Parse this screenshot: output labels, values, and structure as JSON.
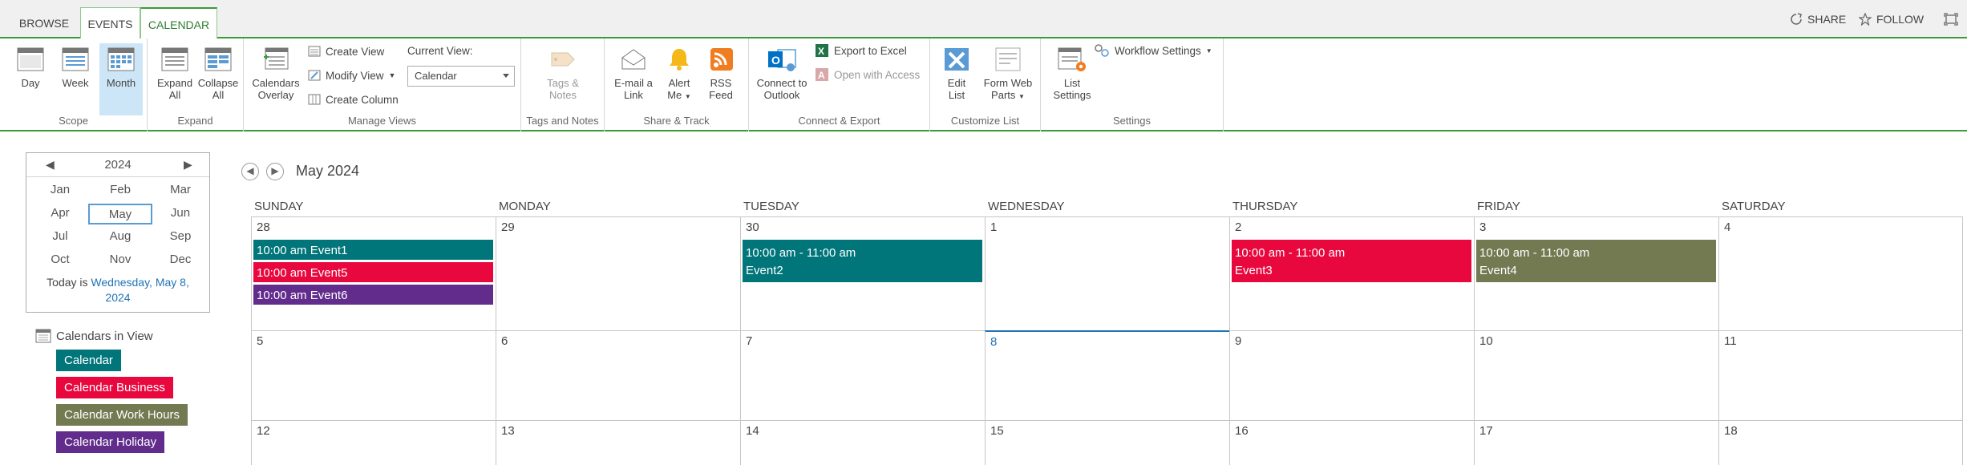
{
  "tabs": {
    "browse": "BROWSE",
    "events": "EVENTS",
    "calendar": "CALENDAR"
  },
  "top_actions": {
    "share": "SHARE",
    "follow": "FOLLOW"
  },
  "ribbon": {
    "scope": {
      "label": "Scope",
      "day": "Day",
      "week": "Week",
      "month": "Month",
      "selected": "Month"
    },
    "expand": {
      "label": "Expand",
      "expand_all_1": "Expand",
      "expand_all_2": "All",
      "collapse_all_1": "Collapse",
      "collapse_all_2": "All"
    },
    "manage_views": {
      "label": "Manage Views",
      "overlay_1": "Calendars",
      "overlay_2": "Overlay",
      "create_view": "Create View",
      "modify_view": "Modify View",
      "create_column": "Create Column",
      "current_view_label": "Current View:",
      "current_view_value": "Calendar"
    },
    "tags": {
      "label": "Tags and Notes",
      "btn_1": "Tags &",
      "btn_2": "Notes"
    },
    "share_track": {
      "label": "Share & Track",
      "email_1": "E-mail a",
      "email_2": "Link",
      "alert_1": "Alert",
      "alert_2": "Me",
      "rss_1": "RSS",
      "rss_2": "Feed"
    },
    "connect": {
      "label": "Connect & Export",
      "outlook_1": "Connect to",
      "outlook_2": "Outlook",
      "excel": "Export to Excel",
      "access": "Open with Access"
    },
    "customize": {
      "label": "Customize List",
      "edit_1": "Edit",
      "edit_2": "List",
      "form_1": "Form Web",
      "form_2": "Parts"
    },
    "settings": {
      "label": "Settings",
      "list_1": "List",
      "list_2": "Settings",
      "workflow": "Workflow Settings"
    }
  },
  "picker": {
    "year": "2024",
    "months": [
      "Jan",
      "Feb",
      "Mar",
      "Apr",
      "May",
      "Jun",
      "Jul",
      "Aug",
      "Sep",
      "Oct",
      "Nov",
      "Dec"
    ],
    "selected": "May",
    "today_prefix": "Today is ",
    "today_link_1": "Wednesday, May 8,",
    "today_link_2": "2024"
  },
  "calendars_in_view": {
    "heading": "Calendars in View",
    "items": [
      {
        "label": "Calendar",
        "color": "#00757a"
      },
      {
        "label": "Calendar Business",
        "color": "#e8083e"
      },
      {
        "label": "Calendar Work Hours",
        "color": "#737a52"
      },
      {
        "label": "Calendar Holiday",
        "color": "#612c8c"
      }
    ]
  },
  "calendar": {
    "title": "May 2024",
    "day_headers": [
      "SUNDAY",
      "MONDAY",
      "TUESDAY",
      "WEDNESDAY",
      "THURSDAY",
      "FRIDAY",
      "SATURDAY"
    ],
    "weeks": [
      [
        "28",
        "29",
        "30",
        "1",
        "2",
        "3",
        "4"
      ],
      [
        "5",
        "6",
        "7",
        "8",
        "9",
        "10",
        "11"
      ],
      [
        "12",
        "13",
        "14",
        "15",
        "16",
        "17",
        "18"
      ]
    ],
    "today": "8",
    "events": [
      {
        "time": "10:00 am",
        "title": "Event1",
        "color": "#00757a"
      },
      {
        "time": "10:00 am",
        "title": "Event5",
        "color": "#e8083e"
      },
      {
        "time": "10:00 am",
        "title": "Event6",
        "color": "#612c8c"
      },
      {
        "time": "10:00 am - 11:00 am",
        "title": "Event2",
        "color": "#00757a"
      },
      {
        "time": "10:00 am - 11:00 am",
        "title": "Event3",
        "color": "#e8083e"
      },
      {
        "time": "10:00 am - 11:00 am",
        "title": "Event4",
        "color": "#737a52"
      }
    ]
  },
  "colors": {
    "accent_green": "#3c9a3c",
    "link_blue": "#1f73b7"
  }
}
